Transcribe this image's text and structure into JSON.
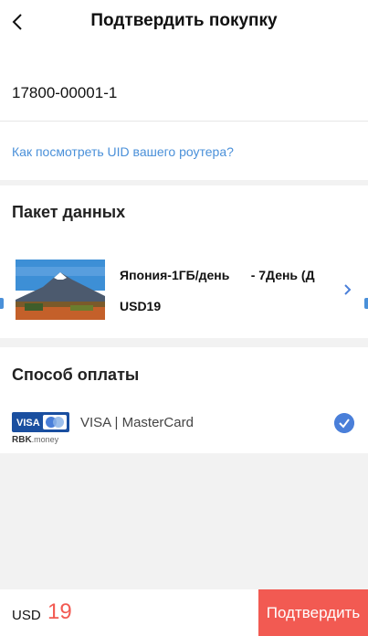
{
  "header": {
    "title": "Подтвердить покупку",
    "back_icon": "chevron-left-icon"
  },
  "uid": {
    "value": "17800-00001-1",
    "help_link": "Как посмотреть UID вашего роутера?"
  },
  "package": {
    "section_title": "Пакет данных",
    "name": "Япония-1ГБ/день      - 7День (Д",
    "price": "USD19",
    "image": "mount-fuji-image"
  },
  "payment": {
    "section_title": "Способ оплаты",
    "method_label": "VISA | MasterCard",
    "provider": "RBK",
    "provider_suffix": ".money",
    "logo_text": "VISA",
    "selected": true,
    "accent_color": "#4a7fd9"
  },
  "footer": {
    "currency": "USD",
    "amount": "19",
    "confirm_label": "Подтвердить",
    "accent_color": "#f25a52"
  }
}
